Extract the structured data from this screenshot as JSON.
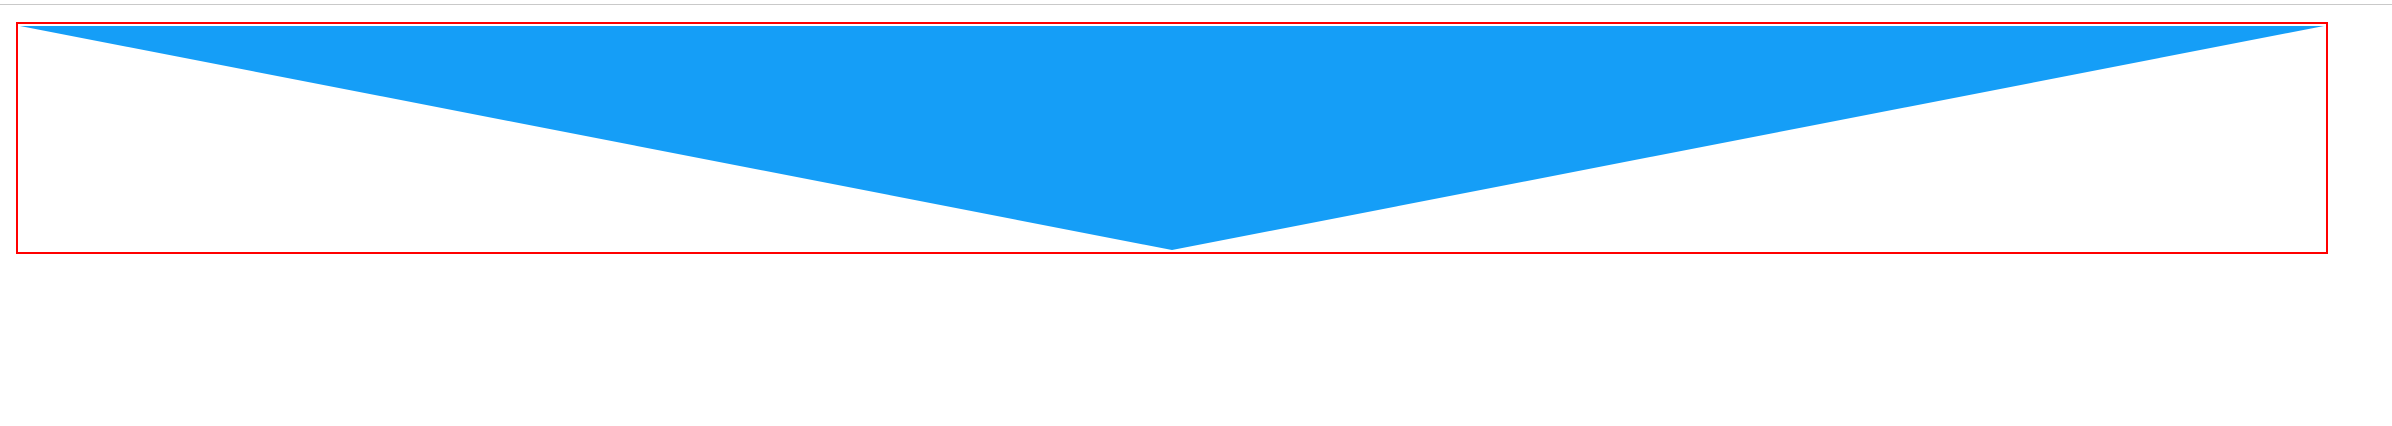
{
  "colors": {
    "frame_border": "#ff0000",
    "triangle_fill": "#159ef7",
    "top_rule": "#c9c9c9",
    "background": "#ffffff"
  },
  "shapes": {
    "triangle": {
      "icon": "down-triangle-shape"
    }
  }
}
